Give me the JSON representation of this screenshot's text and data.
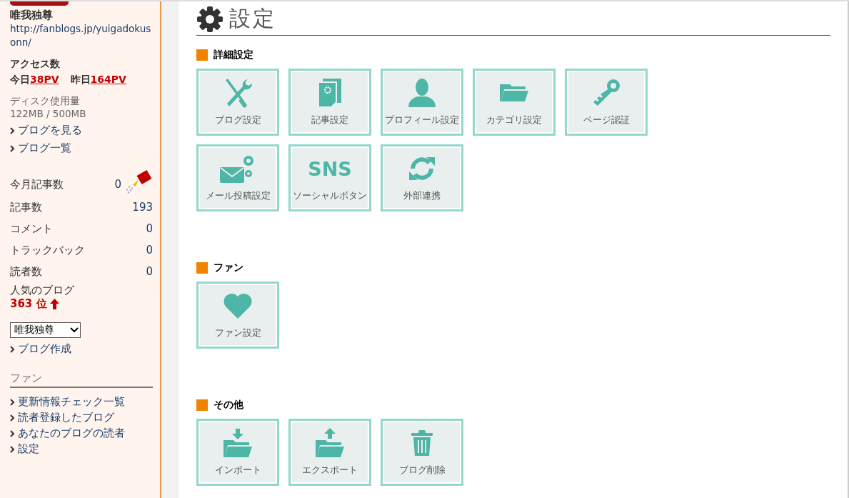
{
  "sidebar": {
    "blog_name": "唯我独尊",
    "blog_url": "http://fanblogs.jp/yuigadokusonn/",
    "access": {
      "title": "アクセス数",
      "today_label": "今日",
      "today_value": "38PV",
      "yesterday_label": "昨日",
      "yesterday_value": "164PV"
    },
    "disk": {
      "label": "ディスク使用量",
      "usage": "122MB / 500MB"
    },
    "links": [
      "ブログを見る",
      "ブログ一覧"
    ],
    "stats": [
      {
        "label": "今月記事数",
        "value": "0",
        "kind": "month"
      },
      {
        "label": "記事数",
        "value": "193",
        "kind": "plain"
      },
      {
        "label": "コメント",
        "value": "0",
        "kind": "plain"
      },
      {
        "label": "トラックバック",
        "value": "0",
        "kind": "plain"
      },
      {
        "label": "読者数",
        "value": "0",
        "kind": "plain"
      }
    ],
    "ranking": {
      "label": "人気のブログ",
      "rank": "363 位"
    },
    "blog_select": {
      "value": "唯我独尊"
    },
    "create_link": "ブログ作成",
    "fan": {
      "title": "ファン",
      "links": [
        "更新情報チェック一覧",
        "読者登録したブログ",
        "あなたのブログの読者",
        "設定"
      ]
    }
  },
  "page_title": "設定",
  "sections": [
    {
      "title": "詳細設定",
      "tiles": [
        {
          "label": "ブログ設定",
          "kind": "tools"
        },
        {
          "label": "記事設定",
          "kind": "document"
        },
        {
          "label": "プロフィール設定",
          "kind": "person"
        },
        {
          "label": "カテゴリ設定",
          "kind": "folder"
        },
        {
          "label": "ページ認証",
          "kind": "key"
        },
        {
          "label": "メール投稿設定",
          "kind": "mail"
        },
        {
          "label": "ソーシャルボタン",
          "kind": "text",
          "icon_text": "SNS"
        },
        {
          "label": "外部連携",
          "kind": "sync"
        }
      ]
    },
    {
      "title": "ファン",
      "tiles": [
        {
          "label": "ファン設定",
          "kind": "heart"
        }
      ]
    },
    {
      "title": "その他",
      "tiles": [
        {
          "label": "インポート",
          "kind": "import"
        },
        {
          "label": "エクスポート",
          "kind": "export"
        },
        {
          "label": "ブログ削除",
          "kind": "trash"
        }
      ]
    }
  ]
}
